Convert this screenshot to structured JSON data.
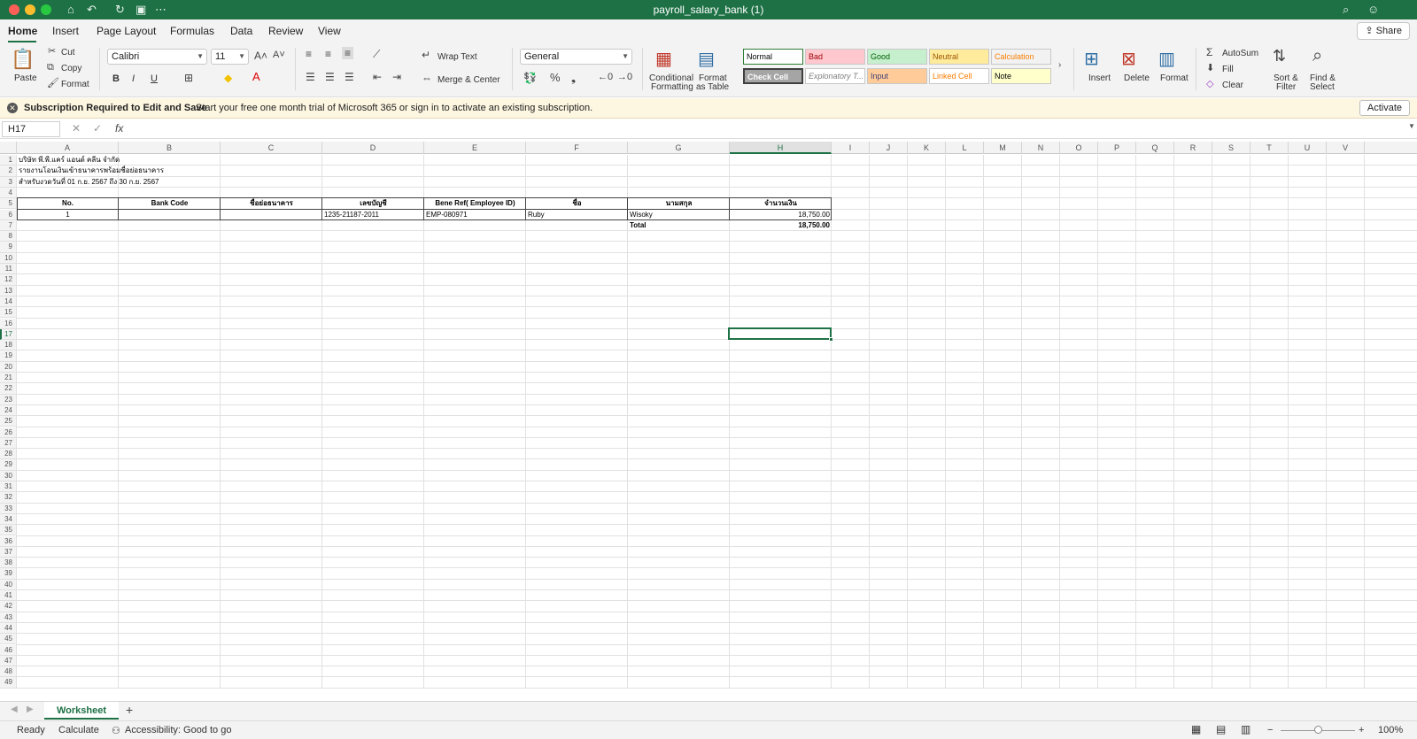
{
  "window": {
    "title": "payroll_salary_bank (1)"
  },
  "tabs": [
    {
      "label": "Home",
      "active": true
    },
    {
      "label": "Insert"
    },
    {
      "label": "Page Layout"
    },
    {
      "label": "Formulas"
    },
    {
      "label": "Data"
    },
    {
      "label": "Review"
    },
    {
      "label": "View"
    }
  ],
  "share_label": "Share",
  "ribbon": {
    "paste": "Paste",
    "cut": "Cut",
    "copy": "Copy",
    "format": "Format",
    "font_name": "Calibri",
    "font_size": "11",
    "bold": "B",
    "italic": "I",
    "underline": "U",
    "wrap_text": "Wrap Text",
    "merge_center": "Merge & Center",
    "number_format": "General",
    "conditional_formatting_1": "Conditional",
    "conditional_formatting_2": "Formatting",
    "format_table_1": "Format",
    "format_table_2": "as Table",
    "styles": [
      {
        "label": "Normal",
        "bg": "#ffffff",
        "fg": "#000000"
      },
      {
        "label": "Bad",
        "bg": "#ffc7ce",
        "fg": "#9c0006"
      },
      {
        "label": "Good",
        "bg": "#c6efce",
        "fg": "#006100"
      },
      {
        "label": "Neutral",
        "bg": "#ffeb9c",
        "fg": "#9c5700"
      },
      {
        "label": "Calculation",
        "bg": "#f2f2f2",
        "fg": "#fa7d00"
      },
      {
        "label": "Check Cell",
        "bg": "#a5a5a5",
        "fg": "#ffffff"
      },
      {
        "label": "Explonatory T...",
        "bg": "#ffffff",
        "fg": "#7f7f7f"
      },
      {
        "label": "Input",
        "bg": "#ffcc99",
        "fg": "#3f3f76"
      },
      {
        "label": "Linked Cell",
        "bg": "#ffffff",
        "fg": "#fa7d00"
      },
      {
        "label": "Note",
        "bg": "#ffffcc",
        "fg": "#000000"
      }
    ],
    "insert": "Insert",
    "delete": "Delete",
    "format_cells": "Format",
    "autosum": "AutoSum",
    "fill": "Fill",
    "clear": "Clear",
    "sort_filter_1": "Sort &",
    "sort_filter_2": "Filter",
    "find_select_1": "Find &",
    "find_select_2": "Select"
  },
  "message_bar": {
    "title": "Subscription Required to Edit and Save",
    "text": "Start your free one month trial of Microsoft 365 or sign in to activate an existing subscription.",
    "button": "Activate"
  },
  "formula_bar": {
    "name_box": "H17",
    "fx": "fx",
    "value": ""
  },
  "sheet": {
    "columns": [
      "A",
      "B",
      "C",
      "D",
      "E",
      "F",
      "G",
      "H",
      "I",
      "J",
      "K",
      "L",
      "M",
      "N",
      "O",
      "P",
      "Q",
      "R",
      "S",
      "T",
      "U",
      "V"
    ],
    "selected_column": "H",
    "selected_row": 17,
    "row_count": 49,
    "rows": {
      "r1": "บริษัท พี.พี.แคร์ แอนด์ คลีน จำกัด",
      "r2": "รายงานโอนเงินเข้าธนาคารพร้อมชื่อย่อธนาคาร",
      "r3": "สำหรับงวดวันที่ 01 ก.ย. 2567 ถึง 30 ก.ย. 2567"
    },
    "headers": [
      "No.",
      "Bank Code",
      "ชื่อย่อธนาคาร",
      "เลขบัญชี",
      "Bene Ref( Employee ID)",
      "ชื่อ",
      "นามสกุล",
      "จำนวนเงิน"
    ],
    "data_rows": [
      [
        "1",
        "",
        "",
        "1235-21187-2011",
        "EMP-080971",
        "Ruby",
        "Wisoky",
        "18,750.00"
      ]
    ],
    "total_label": "Total",
    "total_value": "18,750.00"
  },
  "sheet_tabs": {
    "active": "Worksheet",
    "add": "+"
  },
  "status_bar": {
    "ready": "Ready",
    "calculate": "Calculate",
    "accessibility": "Accessibility: Good to go",
    "zoom": "100%",
    "zoom_level": 0.5
  }
}
